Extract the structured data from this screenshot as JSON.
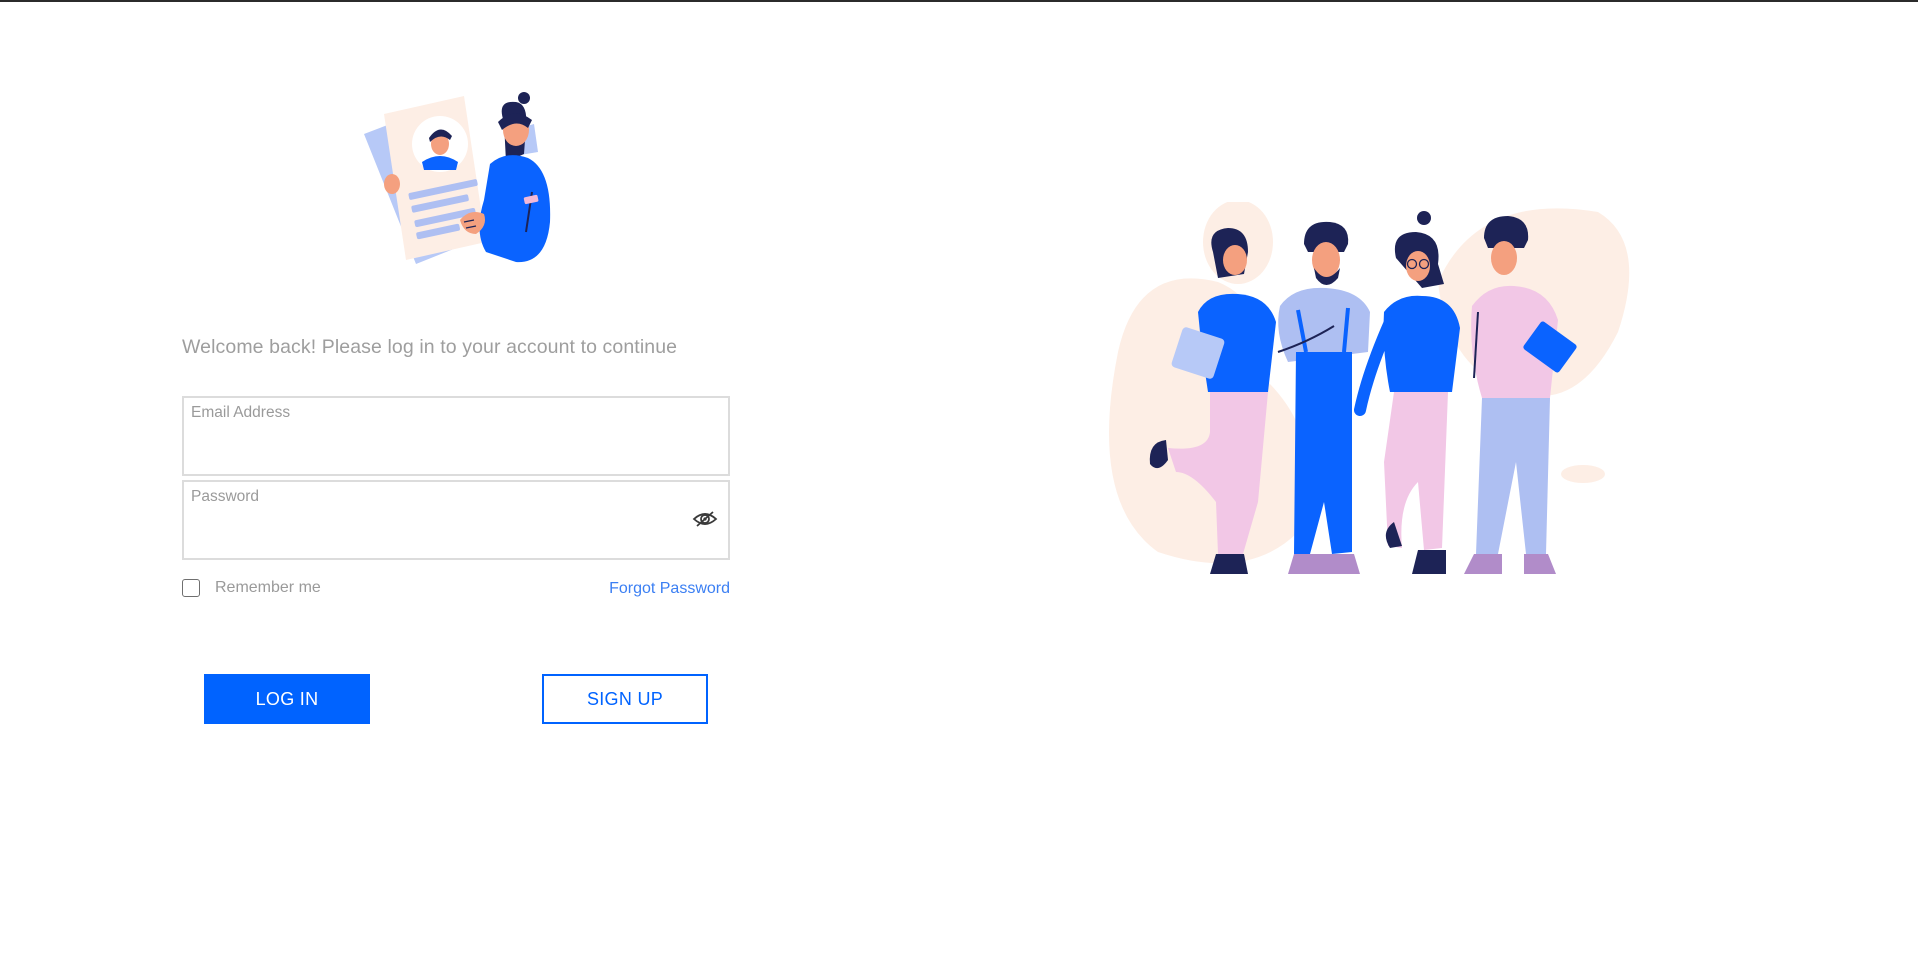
{
  "welcome_text": "Welcome back! Please log in to your account to continue",
  "form": {
    "email_label": "Email Address",
    "email_value": "",
    "password_label": "Password",
    "password_value": "",
    "remember_label": "Remember me",
    "remember_checked": false,
    "forgot_label": "Forgot Password"
  },
  "buttons": {
    "login": "LOG IN",
    "signup": "SIGN UP"
  },
  "icons": {
    "password_toggle": "eye-slash-icon",
    "hero_left": "resume-illustration",
    "hero_right": "team-illustration"
  },
  "colors": {
    "primary": "#0063ff",
    "link": "#3b7ff3",
    "muted_text": "#9e9e9e",
    "field_border": "#dcdcdc",
    "blob": "#fdeee5"
  }
}
